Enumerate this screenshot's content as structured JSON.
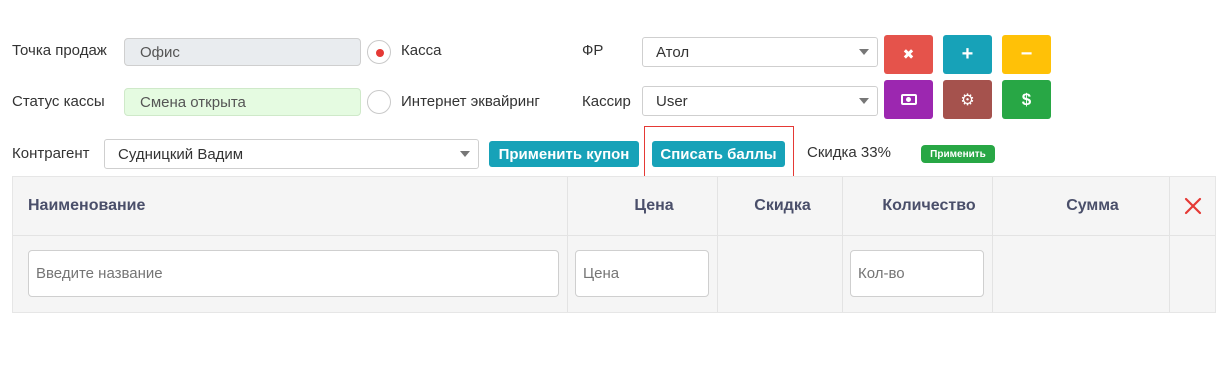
{
  "form": {
    "point_of_sale": {
      "label": "Точка продаж",
      "value": "Офис"
    },
    "register_status": {
      "label": "Статус кассы",
      "value": "Смена открыта"
    },
    "payment_mode": {
      "options": [
        {
          "label": "Касса",
          "selected": true
        },
        {
          "label": "Интернет эквайринг",
          "selected": false
        }
      ]
    },
    "fiscal_registrar": {
      "label": "ФР",
      "value": "Атол"
    },
    "cashier": {
      "label": "Кассир",
      "value": "User"
    },
    "counterparty": {
      "label": "Контрагент",
      "value": "Судницкий Вадим"
    }
  },
  "action_buttons": [
    {
      "name": "close",
      "icon": "x-icon",
      "glyph": "✖",
      "color": "#e5534b"
    },
    {
      "name": "add",
      "icon": "plus-icon",
      "glyph": "+",
      "color": "#17a2b8"
    },
    {
      "name": "subtract",
      "icon": "minus-icon",
      "glyph": "−",
      "color": "#ffc107"
    },
    {
      "name": "cash",
      "icon": "money-bill-icon",
      "glyph": "▣",
      "color": "#9c27b0"
    },
    {
      "name": "settings",
      "icon": "gear-icon",
      "glyph": "⚙",
      "color": "#a5524d"
    },
    {
      "name": "payment",
      "icon": "dollar-icon",
      "glyph": "$",
      "color": "#28a745"
    }
  ],
  "toolbar": {
    "apply_coupon": "Применить купон",
    "write_off_points": "Списать баллы",
    "discount_text": "Скидка 33%",
    "apply": "Применить"
  },
  "colors": {
    "teal": "#17a2b8",
    "green": "#28a745",
    "highlight_border": "#e53935",
    "header_text": "#4a4f6a"
  },
  "table": {
    "columns": [
      "Наименование",
      "Цена",
      "Скидка",
      "Количество",
      "Сумма"
    ],
    "delete_icon": "close-icon",
    "inputs": {
      "name_placeholder": "Введите название",
      "price_placeholder": "Цена",
      "qty_placeholder": "Кол-во"
    }
  }
}
